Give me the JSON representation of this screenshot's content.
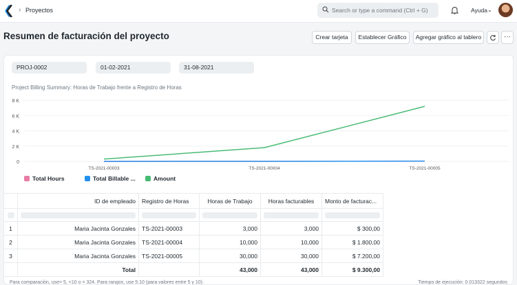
{
  "navbar": {
    "breadcrumb": "Proyectos",
    "search_placeholder": "Search or type a command (Ctrl + G)",
    "help_label": "Ayuda"
  },
  "page": {
    "title": "Resumen de facturación del proyecto",
    "buttons": {
      "create_card": "Crear tarjeta",
      "set_chart": "Establecer Gráfico",
      "add_to_dashboard": "Agregar gráfico al tablero",
      "more": "···"
    }
  },
  "filters": {
    "project": "PROJ-0002",
    "from_date": "01-02-2021",
    "to_date": "31-08-2021"
  },
  "chart_data": {
    "type": "line",
    "title": "Project Billing Summary: Horas de Trabajo frente a Registro de Horas",
    "categories": [
      "TS-2021-00003",
      "TS-2021-00004",
      "TS-2021-00005"
    ],
    "series": [
      {
        "name": "Total Hours",
        "color": "#e77ca4",
        "values": [
          3,
          10,
          30
        ]
      },
      {
        "name": "Total Billable ...",
        "color": "#2490ef",
        "values": [
          3,
          10,
          30
        ]
      },
      {
        "name": "Amount",
        "color": "#48bb74",
        "values": [
          300,
          1800,
          7200
        ]
      }
    ],
    "y_ticks": [
      "8 K",
      "6 K",
      "4 K",
      "2 K",
      "0"
    ],
    "y_tick_values": [
      8000,
      6000,
      4000,
      2000,
      0
    ],
    "ylim": [
      0,
      8000
    ]
  },
  "table": {
    "columns": [
      "ID de empleado",
      "Registro de Horas",
      "Horas de Trabajo",
      "Horas facturables",
      "Monto de facturac..."
    ],
    "rows": [
      {
        "index": "1",
        "employee": "Maria Jacinta Gonzales",
        "timesheet": "TS-2021-00003",
        "hours": "3,000",
        "billable": "3,000",
        "amount": "$ 300,00"
      },
      {
        "index": "2",
        "employee": "Maria Jacinta Gonzales",
        "timesheet": "TS-2021-00004",
        "hours": "10,000",
        "billable": "10,000",
        "amount": "$ 1.800,00"
      },
      {
        "index": "3",
        "employee": "Maria Jacinta Gonzales",
        "timesheet": "TS-2021-00005",
        "hours": "30,000",
        "billable": "30,000",
        "amount": "$ 7.200,00"
      }
    ],
    "totals": {
      "label": "Total",
      "hours": "43,000",
      "billable": "43,000",
      "amount": "$ 9.300,00"
    }
  },
  "footer": {
    "hint": "Para comparación, use> 5, <10 o = 324. Para rangos, use 5:10 (para valores entre 5 y 10).",
    "execution_time": "Tiempo de ejecución: 0.013322 segundos"
  }
}
